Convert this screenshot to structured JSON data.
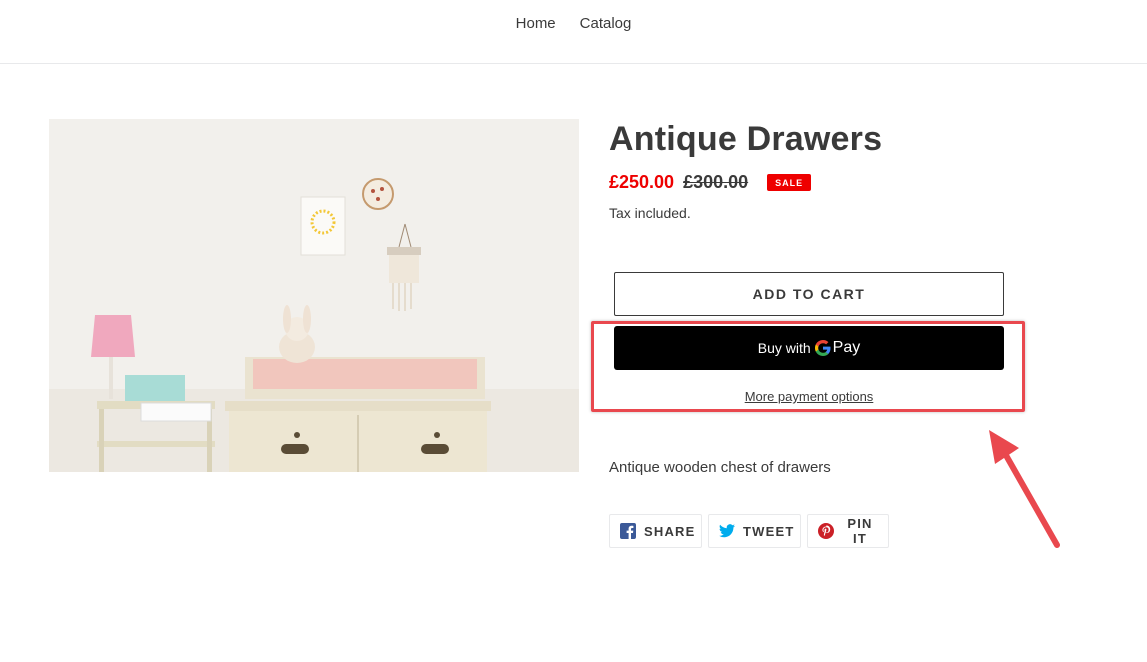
{
  "nav": {
    "items": [
      "Home",
      "Catalog"
    ]
  },
  "product": {
    "image_alt": "Antique Drawers",
    "title": "Antique Drawers",
    "sale_price": "£250.00",
    "compare_price": "£300.00",
    "badge": "SALE",
    "tax_note": "Tax included.",
    "add_to_cart": "ADD TO CART",
    "gpay_buy": "Buy with",
    "gpay_pay": "Pay",
    "more_payment_options": "More payment options",
    "description": "Antique wooden chest of drawers"
  },
  "share": {
    "facebook": "SHARE",
    "twitter": "TWEET",
    "pinterest": "PIN IT"
  },
  "colors": {
    "sale": "#e00000",
    "highlight": "#e9484e",
    "text": "#3a3a3a"
  }
}
